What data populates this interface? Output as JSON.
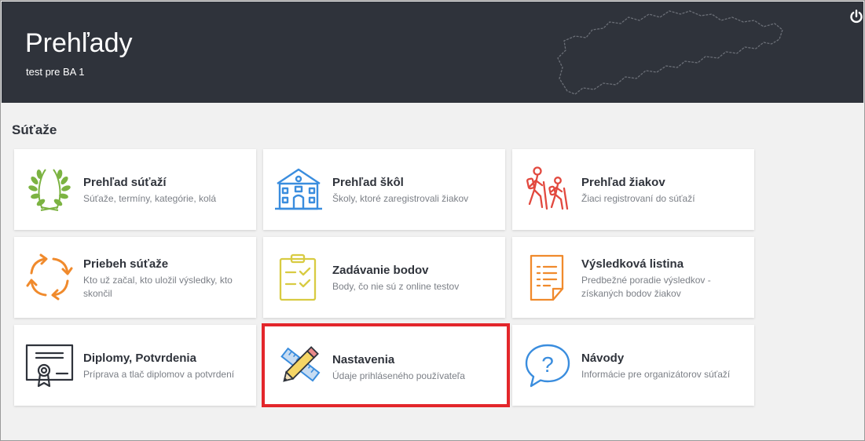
{
  "header": {
    "title": "Prehľady",
    "subtitle": "test pre BA 1",
    "power_icon": "power-icon"
  },
  "section": {
    "title": "Súťaže"
  },
  "colors": {
    "header_bg": "#2f333b",
    "green": "#7cb342",
    "blue": "#3a8dde",
    "red": "#e2493f",
    "orange": "#f08a2c",
    "yellow": "#d8cb42",
    "selection": "#e3262b"
  },
  "cards": [
    {
      "title": "Prehľad súťaží",
      "desc": "Súťaže, termíny, kategórie, kolá",
      "icon": "laurel-wreath-icon"
    },
    {
      "title": "Prehľad škôl",
      "desc": "Školy, ktoré zaregistrovali žiakov",
      "icon": "school-building-icon"
    },
    {
      "title": "Prehľad žiakov",
      "desc": "Žiaci registrovaní do súťaží",
      "icon": "hikers-icon"
    },
    {
      "title": "Priebeh súťaže",
      "desc": "Kto už začal, kto uložil výsledky, kto skončil",
      "icon": "refresh-arrows-icon"
    },
    {
      "title": "Zadávanie bodov",
      "desc": "Body, čo nie sú z online testov",
      "icon": "clipboard-checklist-icon"
    },
    {
      "title": "Výsledková listina",
      "desc": "Predbežné poradie výsledkov - získaných bodov žiakov",
      "icon": "document-list-icon"
    },
    {
      "title": "Diplomy, Potvrdenia",
      "desc": "Príprava a tlač diplomov a potvrdení",
      "icon": "certificate-icon"
    },
    {
      "title": "Nastavenia",
      "desc": "Údaje prihláseného používateľa",
      "icon": "ruler-pencil-icon",
      "selected": true
    },
    {
      "title": "Návody",
      "desc": "Informácie pre organizátorov súťaží",
      "icon": "question-bubble-icon"
    }
  ]
}
